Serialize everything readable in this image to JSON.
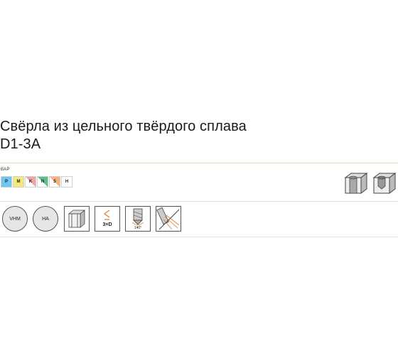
{
  "title": {
    "line1": "Свёрла из цельного твёрдого сплава",
    "line2": "D1-3A"
  },
  "vap_label": "ВАР",
  "iso_groups": [
    {
      "code": "P",
      "color": "#6cc7f0",
      "filled": true
    },
    {
      "code": "M",
      "color": "#f6e97a",
      "filled": true
    },
    {
      "code": "K",
      "color": "#f2a3a3",
      "filled": false
    },
    {
      "code": "N",
      "color": "#5cbf8a",
      "filled": false
    },
    {
      "code": "S",
      "color": "#f5b27a",
      "filled": false
    },
    {
      "code": "H",
      "color": "#cfcfcf",
      "filled": false
    }
  ],
  "hole_icons": [
    "through-hole-icon",
    "blind-hole-icon"
  ],
  "features": {
    "material": "VHM",
    "coating": "HA",
    "depth": "3×D",
    "depth_icon": "depth-ratio-icon",
    "point_angle": "140°",
    "point_icon": "point-angle-icon",
    "shank_icon": "cylindrical-shank-icon",
    "coolant_icon": "internal-coolant-icon"
  }
}
